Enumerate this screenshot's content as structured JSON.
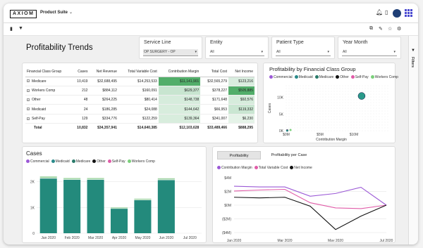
{
  "app": {
    "logo": "AXIOM",
    "suite_label": "Product Suite"
  },
  "icons": {
    "bell": "bell-icon",
    "note": "note-icon",
    "avatar": "avatar",
    "apps": "apps-grid-icon"
  },
  "page": {
    "title": "Profitability Trends",
    "filters_tab": "Filters"
  },
  "filters": [
    {
      "label": "Service Line",
      "value": "OP SURGERY - OP"
    },
    {
      "label": "Entity",
      "value": "All"
    },
    {
      "label": "Patient Type",
      "value": "All"
    },
    {
      "label": "Year Month",
      "value": "All"
    }
  ],
  "table": {
    "headers": [
      "Financial Class Group",
      "Cases",
      "Net Revenue",
      "Total Variable Cost",
      "Contribution Margin",
      "Total Cost",
      "Net Income"
    ],
    "rows": [
      [
        "Medicare",
        "10,419",
        "$32,688,495",
        "$14,253,533",
        "$11,141,901",
        "$32,565,279",
        "$123,216"
      ],
      [
        "Workers Comp",
        "212",
        "$884,112",
        "$160,091",
        "$629,377",
        "$378,227",
        "$505,885"
      ],
      [
        "Other",
        "48",
        "$264,225",
        "$80,414",
        "$148,738",
        "$171,648",
        "$92,576"
      ],
      [
        "Medicaid",
        "24",
        "$186,285",
        "$24,088",
        "$144,642",
        "$66,953",
        "$119,332"
      ],
      [
        "Self-Pay",
        "129",
        "$334,776",
        "$122,259",
        "$139,364",
        "$341,007",
        "$6,230"
      ]
    ],
    "total": [
      "Total",
      "10,832",
      "$34,357,941",
      "$14,640,385",
      "$12,103,628",
      "$33,489,466",
      "$888,295"
    ],
    "cm_shade": [
      1.0,
      0.18,
      0.08,
      0.07,
      0.07
    ],
    "ni_shade": [
      0.1,
      1.0,
      0.12,
      0.2,
      0.02
    ],
    "accent_green": "#3fa55a"
  },
  "scatter": {
    "title": "Profitability by Financial Class Group",
    "legend": [
      {
        "name": "Commercial",
        "color": "#9b59d6"
      },
      {
        "name": "Medicaid",
        "color": "#2a8a8a"
      },
      {
        "name": "Medicare",
        "color": "#2a7a6a"
      },
      {
        "name": "Other",
        "color": "#111111"
      },
      {
        "name": "Self-Pay",
        "color": "#e05ca8"
      },
      {
        "name": "Workers Comp",
        "color": "#7ad07a"
      }
    ],
    "chart_data": {
      "type": "scatter",
      "xlabel": "Contribution Margin",
      "ylabel": "Cases",
      "x_ticks": [
        "$0M",
        "$5M",
        "$10M"
      ],
      "y_ticks": [
        "0K",
        "5K",
        "10K"
      ],
      "xlim": [
        0,
        15
      ],
      "ylim": [
        0,
        13.5
      ],
      "points": [
        {
          "name": "Medicare",
          "x": 11.14,
          "y": 10.42
        },
        {
          "name": "Workers Comp",
          "x": 0.63,
          "y": 0.21
        },
        {
          "name": "Self-Pay",
          "x": 0.14,
          "y": 0.13
        },
        {
          "name": "Other",
          "x": 0.15,
          "y": 0.05
        },
        {
          "name": "Medicaid",
          "x": 0.14,
          "y": 0.02
        }
      ]
    }
  },
  "cases": {
    "title": "Cases",
    "legend": [
      {
        "name": "Commercial",
        "color": "#9b59d6"
      },
      {
        "name": "Medicaid",
        "color": "#2a8a8a"
      },
      {
        "name": "Medicare",
        "color": "#2a7a6a"
      },
      {
        "name": "Other",
        "color": "#111111"
      },
      {
        "name": "Self-Pay",
        "color": "#e05ca8"
      },
      {
        "name": "Workers Comp",
        "color": "#7ad07a"
      }
    ],
    "chart_data": {
      "type": "bar",
      "categories": [
        "Jan 2020",
        "Feb 2020",
        "Mar 2020",
        "Apr 2020",
        "May 2020",
        "Jun 2020",
        "Jul 2020"
      ],
      "tick_labels": [
        "Jan 2020",
        "Feb 2020",
        "Mar 2020",
        "Apr 2020",
        "May 2020",
        "Jun 2020",
        "Jul 2020"
      ],
      "y_ticks": [
        "0",
        "1K",
        "2K"
      ],
      "ylim": [
        0,
        2.45
      ],
      "series": [
        {
          "name": "Medicare",
          "color": "#238a7c",
          "values": [
            2.12,
            2.07,
            2.07,
            0.95,
            1.28,
            2.06,
            0
          ]
        },
        {
          "name": "Self-Pay",
          "color": "#cfe9d6",
          "values": [
            0.03,
            0.03,
            0.03,
            0.02,
            0.03,
            0.03,
            0
          ]
        },
        {
          "name": "Workers Comp",
          "color": "#9fd4a3",
          "values": [
            0.05,
            0.04,
            0.04,
            0.03,
            0.03,
            0.04,
            0
          ]
        }
      ]
    }
  },
  "profit": {
    "tabs": [
      "Profitability",
      "Profitability per Case"
    ],
    "legend": [
      {
        "name": "Contribution Margin",
        "color": "#9b59d6"
      },
      {
        "name": "Total Variable Cost",
        "color": "#e05ca8"
      },
      {
        "name": "Net Income",
        "color": "#111111"
      }
    ],
    "chart_data": {
      "type": "line",
      "categories": [
        "Jan 2020",
        "Feb 2020",
        "Mar 2020",
        "Apr 2020",
        "May 2020",
        "Jun 2020",
        "Jul 2020"
      ],
      "y_ticks": [
        "$2M",
        "$0M",
        "($2M)",
        "($4M)"
      ],
      "y_extra_tick": "$4M",
      "ylim": [
        -4.5,
        4.5
      ],
      "series": [
        {
          "name": "Contribution Margin",
          "color": "#9b59d6",
          "values": [
            2.75,
            2.65,
            2.65,
            1.3,
            1.7,
            2.6,
            0
          ]
        },
        {
          "name": "Total Variable Cost",
          "color": "#e05ca8",
          "values": [
            2.05,
            2.2,
            2.3,
            0.35,
            -0.4,
            -0.5,
            0
          ]
        },
        {
          "name": "Net Income",
          "color": "#111111",
          "values": [
            1.15,
            1.05,
            1.15,
            -0.15,
            -3.55,
            -1.6,
            0
          ]
        }
      ]
    }
  }
}
